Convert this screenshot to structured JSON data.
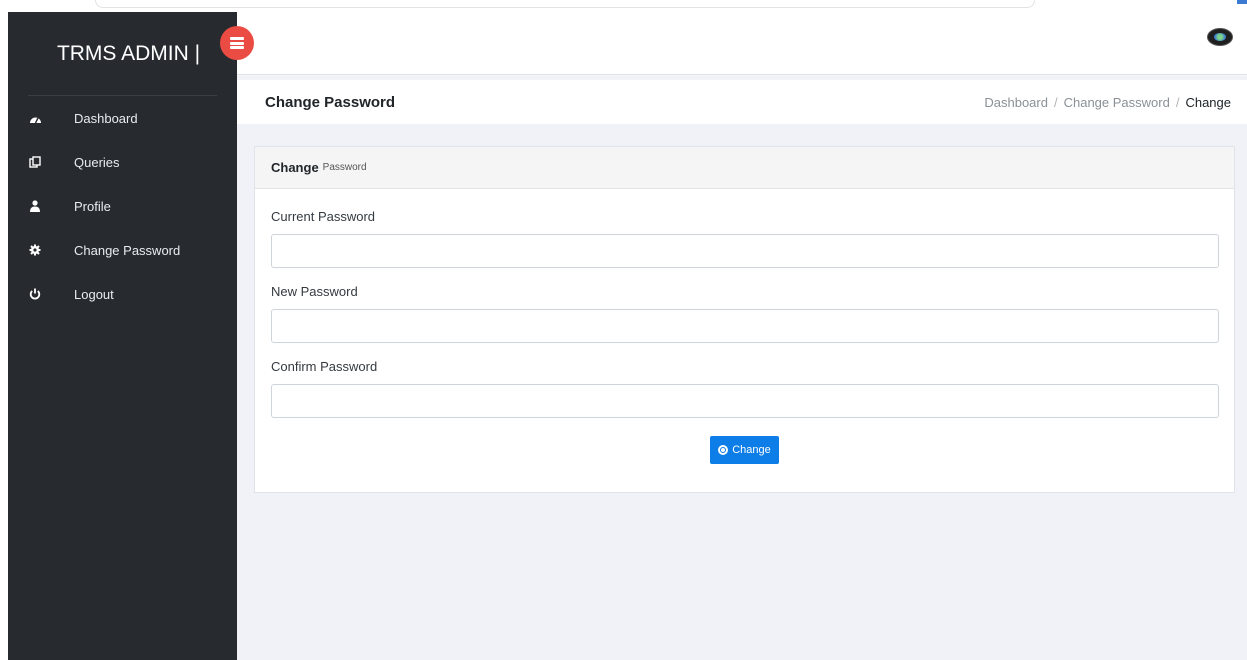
{
  "sidebar": {
    "brand": "TRMS ADMIN |",
    "items": [
      {
        "label": "Dashboard",
        "icon": "dashboard-icon"
      },
      {
        "label": "Queries",
        "icon": "queries-icon"
      },
      {
        "label": "Profile",
        "icon": "user-icon"
      },
      {
        "label": "Change Password",
        "icon": "gear-icon"
      },
      {
        "label": "Logout",
        "icon": "power-icon"
      }
    ]
  },
  "header": {
    "toggle_icon": "menu-toggle-icon",
    "avatar_icon": "user-avatar"
  },
  "page": {
    "title": "Change Password",
    "breadcrumb": [
      "Dashboard",
      "Change Password",
      "Change"
    ]
  },
  "card": {
    "title_strong": "Change",
    "title_small": "Password",
    "fields": [
      {
        "label": "Current Password",
        "value": "",
        "placeholder": ""
      },
      {
        "label": "New Password",
        "value": "",
        "placeholder": ""
      },
      {
        "label": "Confirm Password",
        "value": "",
        "placeholder": ""
      }
    ],
    "submit_label": "Change"
  },
  "colors": {
    "sidebar_bg": "#272b30",
    "toggle_bg": "#ea4c43",
    "primary_button": "#0d7de8",
    "main_bg": "#f1f2f7"
  }
}
